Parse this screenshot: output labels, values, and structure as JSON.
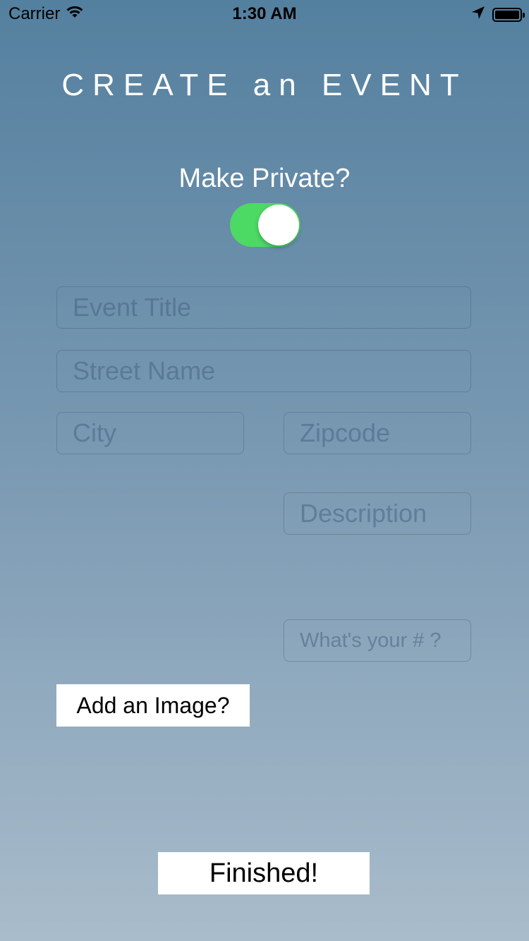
{
  "status_bar": {
    "carrier": "Carrier",
    "time": "1:30 AM",
    "icons": [
      "wifi-icon",
      "location-arrow-icon",
      "battery-icon"
    ]
  },
  "page": {
    "title": "CREATE an EVENT"
  },
  "private_toggle": {
    "label": "Make Private?",
    "on": true,
    "on_color": "#4cd964"
  },
  "form": {
    "event_title": {
      "placeholder": "Event Title",
      "value": ""
    },
    "street_name": {
      "placeholder": "Street Name",
      "value": ""
    },
    "city": {
      "placeholder": "City",
      "value": ""
    },
    "zipcode": {
      "placeholder": "Zipcode",
      "value": ""
    },
    "description": {
      "placeholder": "Description",
      "value": ""
    },
    "phone": {
      "placeholder": "What's your # ?",
      "value": ""
    }
  },
  "buttons": {
    "add_image": "Add an Image?",
    "finished": "Finished!"
  },
  "colors": {
    "background_top": "#54809f",
    "background_bottom": "#a9bccb",
    "button_bg": "#ffffff"
  }
}
